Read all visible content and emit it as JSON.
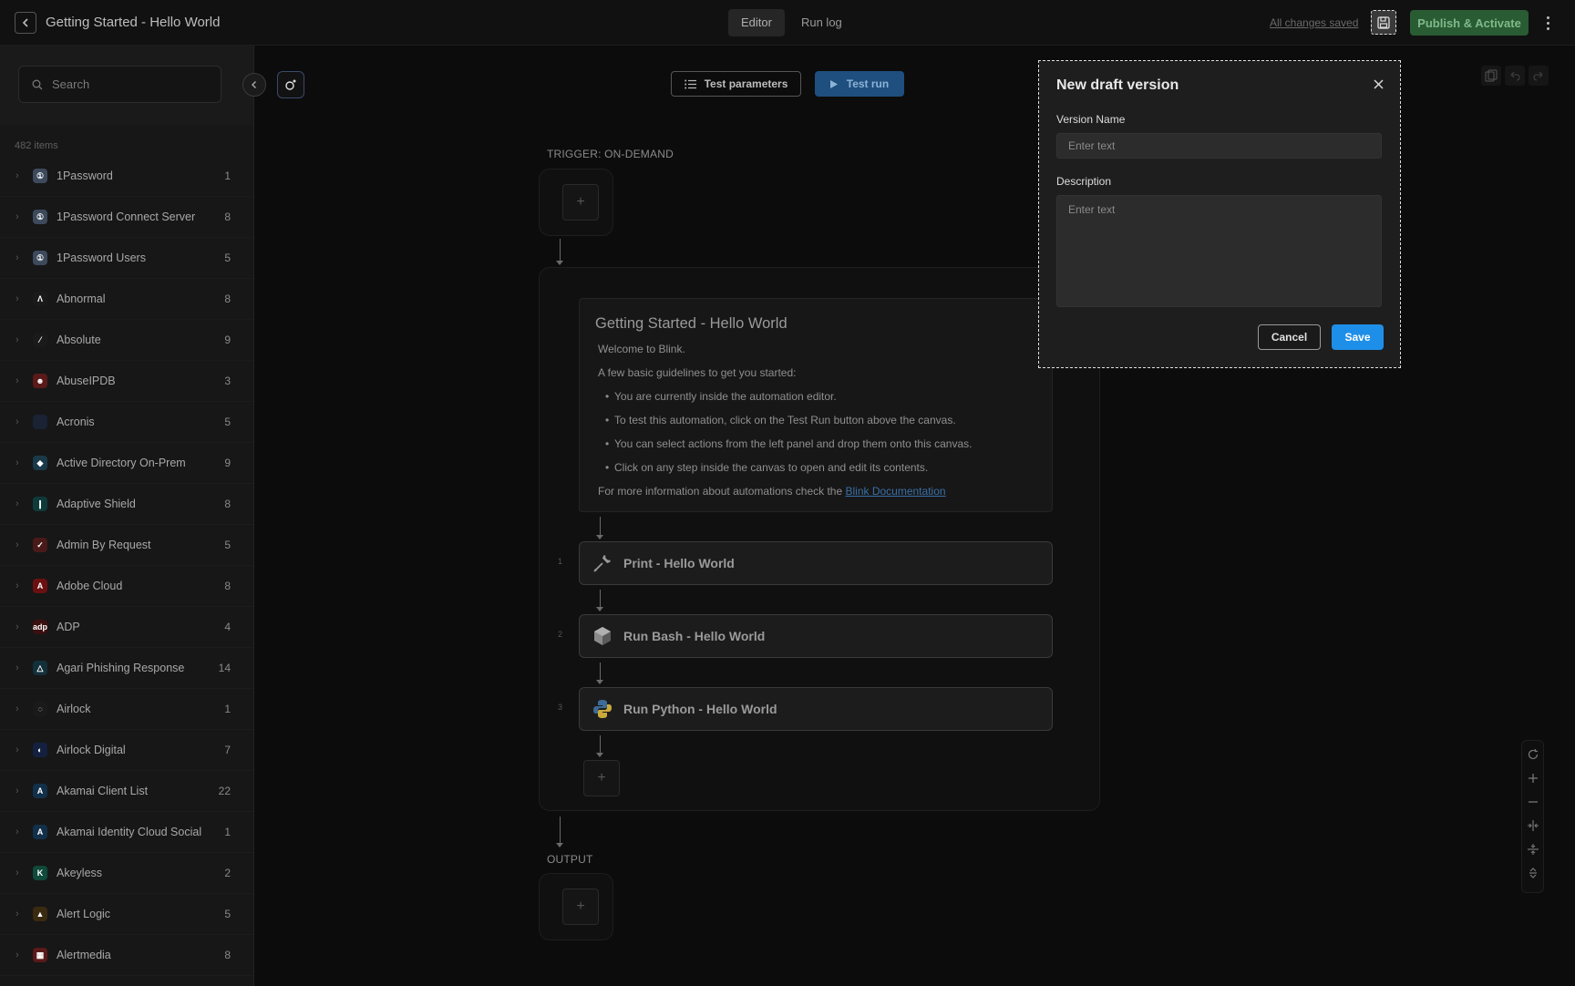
{
  "header": {
    "title": "Getting Started - Hello World",
    "tabs": [
      {
        "label": "Editor",
        "active": true
      },
      {
        "label": "Run log",
        "active": false
      }
    ],
    "saved_status": "All changes saved",
    "publish_label": "Publish & Activate"
  },
  "sidebar": {
    "search_placeholder": "Search",
    "items_count": "482 items",
    "items": [
      {
        "label": "1Password",
        "count": "1",
        "color": "#3d4a5c",
        "icon": "1password-icon",
        "glyph": "①"
      },
      {
        "label": "1Password Connect Server",
        "count": "8",
        "color": "#3d4a5c",
        "icon": "1password-icon",
        "glyph": "①"
      },
      {
        "label": "1Password Users",
        "count": "5",
        "color": "#3d4a5c",
        "icon": "1password-icon",
        "glyph": "①"
      },
      {
        "label": "Abnormal",
        "count": "8",
        "color": "#1a1a1a",
        "icon": "abnormal-icon",
        "glyph": "Λ"
      },
      {
        "label": "Absolute",
        "count": "9",
        "color": "#1a1a1a",
        "icon": "absolute-icon",
        "glyph": "⁄"
      },
      {
        "label": "AbuseIPDB",
        "count": "3",
        "color": "#5a1a1a",
        "icon": "abuseipdb-icon",
        "glyph": "☻"
      },
      {
        "label": "Acronis",
        "count": "5",
        "color": "#1a2233",
        "icon": "acronis-icon",
        "glyph": ""
      },
      {
        "label": "Active Directory On-Prem",
        "count": "9",
        "color": "#1a3a4a",
        "icon": "active-directory-icon",
        "glyph": "◆"
      },
      {
        "label": "Adaptive Shield",
        "count": "8",
        "color": "#0f3a3a",
        "icon": "adaptive-shield-icon",
        "glyph": "❙"
      },
      {
        "label": "Admin By Request",
        "count": "5",
        "color": "#4a1a1a",
        "icon": "admin-by-request-icon",
        "glyph": "✓"
      },
      {
        "label": "Adobe Cloud",
        "count": "8",
        "color": "#6a1010",
        "icon": "adobe-icon",
        "glyph": "A"
      },
      {
        "label": "ADP",
        "count": "4",
        "color": "#3a1010",
        "icon": "adp-icon",
        "glyph": "adp"
      },
      {
        "label": "Agari Phishing Response",
        "count": "14",
        "color": "#12303a",
        "icon": "agari-icon",
        "glyph": "△"
      },
      {
        "label": "Airlock",
        "count": "1",
        "color": "#1a1a1a",
        "icon": "airlock-icon",
        "glyph": "◌"
      },
      {
        "label": "Airlock Digital",
        "count": "7",
        "color": "#142040",
        "icon": "airlock-digital-icon",
        "glyph": "◐"
      },
      {
        "label": "Akamai Client List",
        "count": "22",
        "color": "#12304a",
        "icon": "akamai-icon",
        "glyph": "A"
      },
      {
        "label": "Akamai Identity Cloud Social",
        "count": "1",
        "color": "#12304a",
        "icon": "akamai-icon",
        "glyph": "A"
      },
      {
        "label": "Akeyless",
        "count": "2",
        "color": "#0f4a3a",
        "icon": "akeyless-icon",
        "glyph": "K"
      },
      {
        "label": "Alert Logic",
        "count": "5",
        "color": "#3a2a10",
        "icon": "alert-logic-icon",
        "glyph": "▲"
      },
      {
        "label": "Alertmedia",
        "count": "8",
        "color": "#5a1a1a",
        "icon": "alertmedia-icon",
        "glyph": "▦"
      }
    ]
  },
  "toolbar": {
    "test_params_label": "Test parameters",
    "test_run_label": "Test run"
  },
  "canvas": {
    "trigger_label": "TRIGGER: ON-DEMAND",
    "output_label": "OUTPUT",
    "note": {
      "title": "Getting Started - Hello World",
      "welcome": "Welcome to Blink.",
      "intro": "A few basic guidelines to get you started:",
      "bullets": [
        "You are currently inside the automation editor.",
        "To test this automation, click on the Test Run button above the canvas.",
        "You can select actions from the left panel and drop them onto this canvas.",
        "Click on any step inside the canvas to open and edit its contents."
      ],
      "more_info": "For more information about automations check the ",
      "link_text": "Blink Documentation"
    },
    "steps": [
      {
        "num": "1",
        "label": "Print - Hello World",
        "icon": "wrench-icon"
      },
      {
        "num": "2",
        "label": "Run Bash - Hello World",
        "icon": "bash-icon"
      },
      {
        "num": "3",
        "label": "Run Python - Hello World",
        "icon": "python-icon"
      }
    ]
  },
  "modal": {
    "title": "New draft version",
    "version_name_label": "Version Name",
    "version_name_placeholder": "Enter text",
    "description_label": "Description",
    "description_placeholder": "Enter text",
    "cancel_label": "Cancel",
    "save_label": "Save"
  }
}
